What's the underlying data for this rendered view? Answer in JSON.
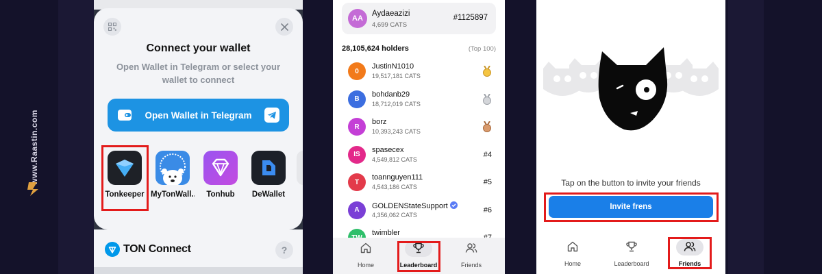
{
  "watermark": {
    "text": "www.Raastin.com"
  },
  "panel1": {
    "title": "Connect your wallet",
    "subtitle": "Open Wallet in Telegram or select your wallet to connect",
    "telegram_button": "Open Wallet in Telegram",
    "wallets": [
      {
        "name": "Tonkeeper",
        "icon": "tonkeeper-icon"
      },
      {
        "name": "MyTonWall...",
        "icon": "mytonwallet-icon"
      },
      {
        "name": "Tonhub",
        "icon": "tonhub-icon"
      },
      {
        "name": "DeWallet",
        "icon": "dewallet-icon"
      }
    ],
    "footer_brand": "TON Connect",
    "help_label": "?"
  },
  "panel2": {
    "me": {
      "initials": "AA",
      "name": "Aydaeazizi",
      "score": "4,699 CATS",
      "rank": "#1125897"
    },
    "holders": "28,105,624 holders",
    "top_label": "(Top 100)",
    "rows": [
      {
        "initials": "0",
        "color": "#f27a1a",
        "name": "JustinN1010",
        "score": "19,517,181 CATS",
        "medal": "gold"
      },
      {
        "initials": "B",
        "color": "#3c6ee0",
        "name": "bohdanb29",
        "score": "18,712,019 CATS",
        "medal": "silver"
      },
      {
        "initials": "R",
        "color": "#c43fd6",
        "name": "borz",
        "score": "10,393,243 CATS",
        "medal": "bronze"
      },
      {
        "initials": "IS",
        "color": "#e3298a",
        "name": "spasecex",
        "score": "4,549,812 CATS",
        "rank": "#4"
      },
      {
        "initials": "T",
        "color": "#e33a4a",
        "name": "toannguyen111",
        "score": "4,543,186 CATS",
        "rank": "#5"
      },
      {
        "initials": "A",
        "color": "#7a3fd6",
        "name": "GOLDENStateSupport",
        "score": "4,356,062 CATS",
        "rank": "#6",
        "verified": true
      },
      {
        "initials": "TW",
        "color": "#2fbf6a",
        "name": "twimbler",
        "score": "",
        "rank": "#7"
      }
    ],
    "tabs": {
      "home": "Home",
      "leaderboard": "Leaderboard",
      "friends": "Friends"
    }
  },
  "panel3": {
    "invite_text": "Tap on the button to invite your friends",
    "invite_button": "Invite frens",
    "tabs": {
      "home": "Home",
      "leaderboard": "Leaderboard",
      "friends": "Friends"
    }
  },
  "colors": {
    "highlight": "#e31b1b",
    "telegram_blue": "#1d93e3",
    "invite_blue": "#1a7fe8"
  }
}
